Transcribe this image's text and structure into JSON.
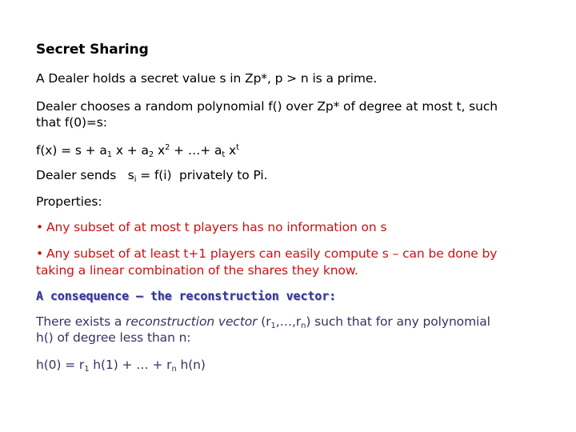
{
  "slide": {
    "title": "Secret Sharing",
    "line1": "A Dealer holds a secret value s in Zp*, p > n is a prime.",
    "line2a": "Dealer chooses a random polynomial f() over Zp* of degree at most t, such",
    "line2b": "that f(0)=s:",
    "poly": {
      "p0": "f(x) = s + a",
      "s1": "1",
      "p1": " x + a",
      "s2": "2",
      "p2": " x",
      "e2": "2",
      "p3": "+ …+ a",
      "st": "t",
      "p4": " x",
      "et": "t"
    },
    "send": {
      "pre": "Dealer sends   s",
      "sub": "i",
      "post": " = f(i)  privately to Pi."
    },
    "properties_label": "Properties:",
    "bullets": [
      {
        "symbol": "•",
        "lines": [
          "Any subset of at most t players has no information on s"
        ]
      },
      {
        "symbol": "•",
        "lines": [
          "Any subset of at least t+1 players can easily compute s – can be done by",
          "taking a linear combination of the shares they know."
        ]
      }
    ],
    "subheading": "A consequence – the reconstruction vector:",
    "recon": {
      "pre": "There exists a ",
      "italic": "reconstruction vector",
      "vec_open": " (r",
      "vec_s1": "1",
      "vec_mid": ",…,r",
      "vec_sn": "n",
      "vec_close": ") such that for any polynomial",
      "line2": "h() of degree less than n:"
    },
    "formula": {
      "p0": "h(0) = r",
      "s1": "1",
      "p1": " h(1) + … + r",
      "sn": "n",
      "p2": " h(n)"
    }
  },
  "colors": {
    "text": "#000000",
    "bullets": "#cc1111",
    "subheading": "#333399",
    "recon_text": "#333366"
  }
}
